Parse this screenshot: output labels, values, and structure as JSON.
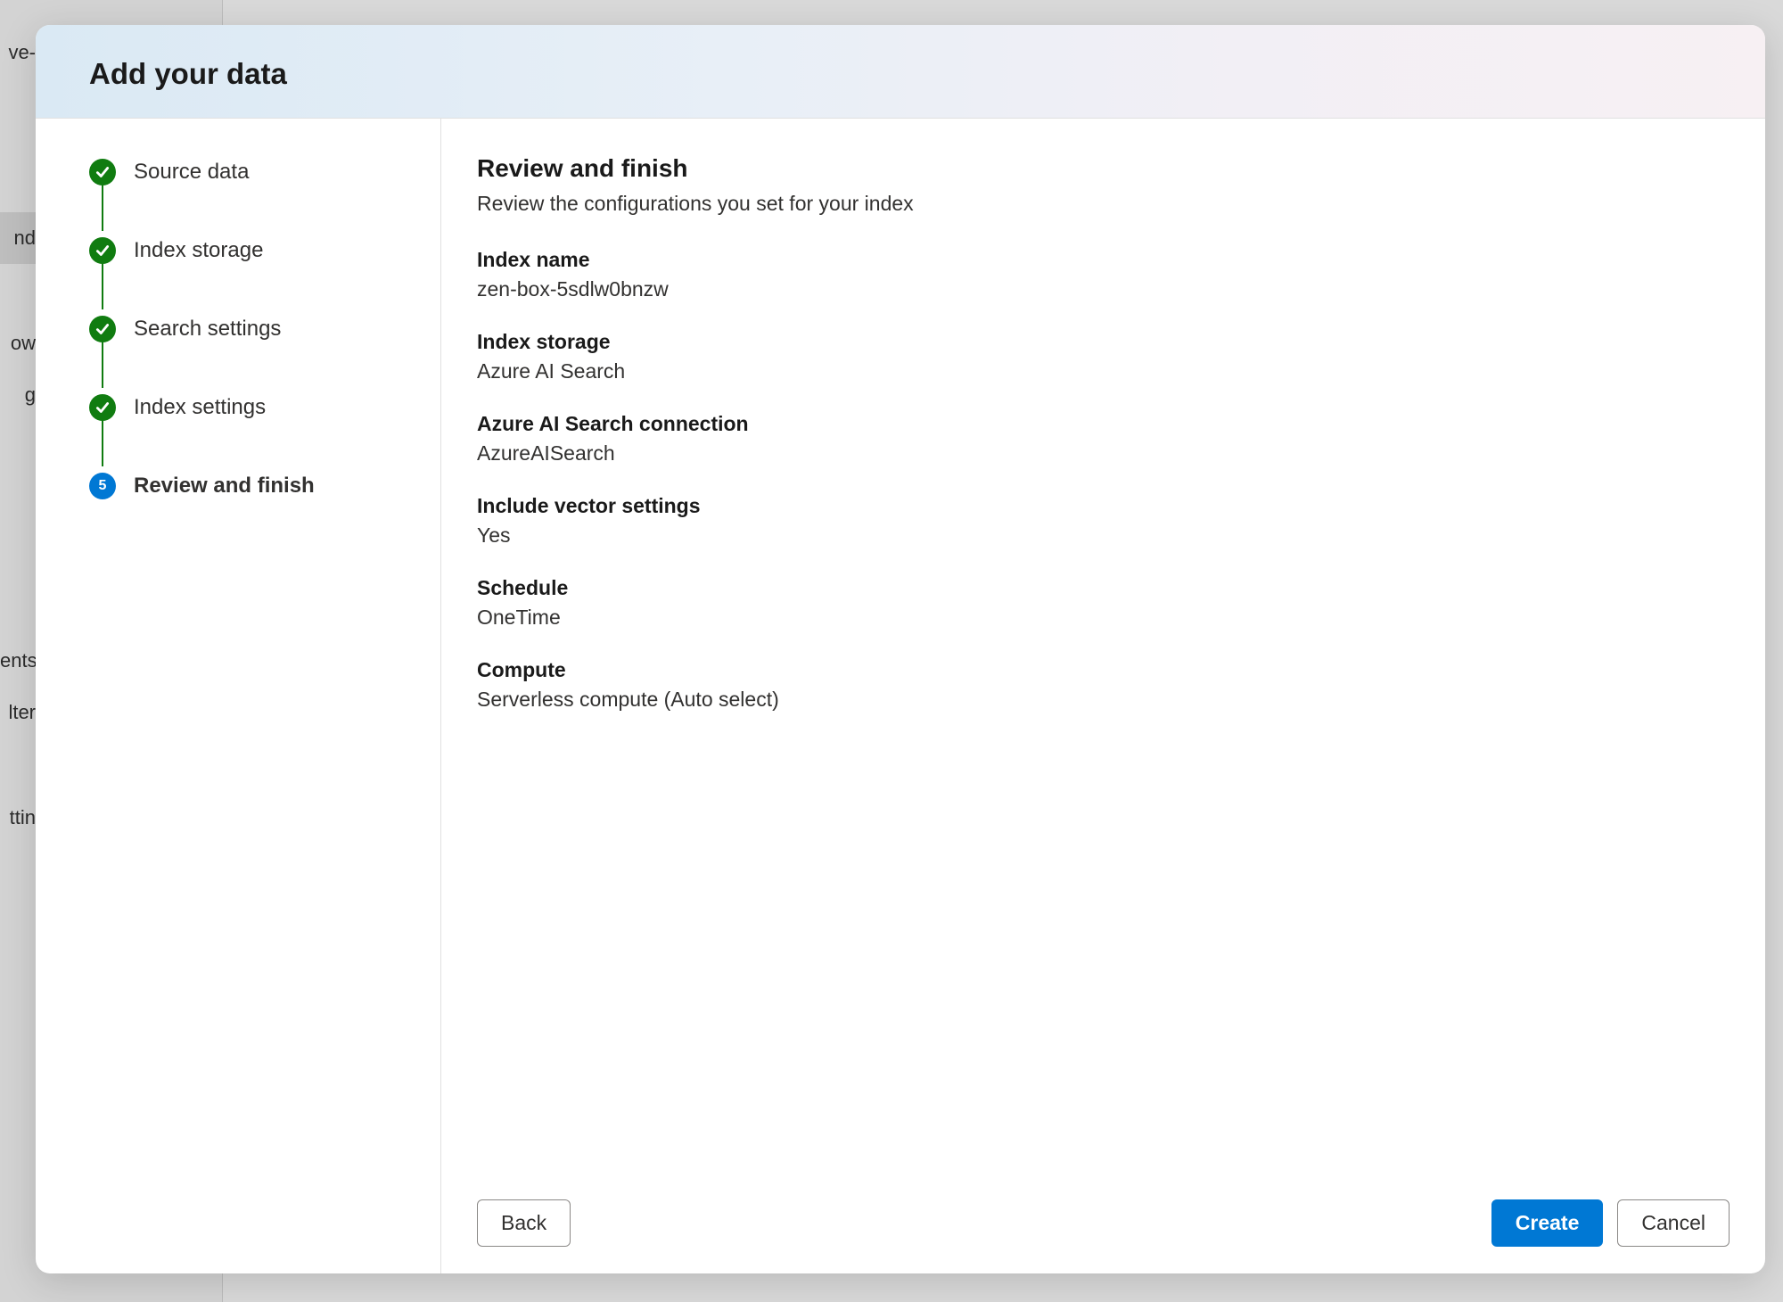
{
  "background": {
    "sidebar_fragments": [
      "ve-",
      "nd",
      "ow",
      "g",
      "ents",
      "lter",
      "ttin"
    ]
  },
  "modal": {
    "title": "Add your data"
  },
  "stepper": {
    "items": [
      {
        "label": "Source data",
        "state": "completed"
      },
      {
        "label": "Index storage",
        "state": "completed"
      },
      {
        "label": "Search settings",
        "state": "completed"
      },
      {
        "label": "Index settings",
        "state": "completed"
      },
      {
        "label": "Review and finish",
        "state": "current",
        "number": "5"
      }
    ]
  },
  "review": {
    "heading": "Review and finish",
    "subheading": "Review the configurations you set for your index",
    "fields": [
      {
        "label": "Index name",
        "value": "zen-box-5sdlw0bnzw"
      },
      {
        "label": "Index storage",
        "value": "Azure AI Search"
      },
      {
        "label": "Azure AI Search connection",
        "value": "AzureAISearch"
      },
      {
        "label": "Include vector settings",
        "value": "Yes"
      },
      {
        "label": "Schedule",
        "value": "OneTime"
      },
      {
        "label": "Compute",
        "value": "Serverless compute (Auto select)"
      }
    ]
  },
  "buttons": {
    "back": "Back",
    "create": "Create",
    "cancel": "Cancel"
  }
}
